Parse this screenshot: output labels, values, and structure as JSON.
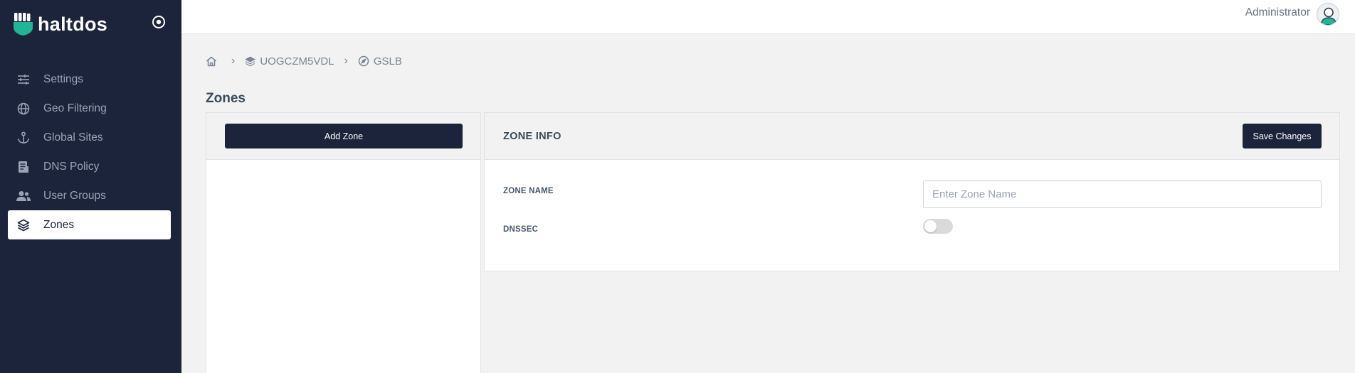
{
  "brand": {
    "name": "haltdos",
    "logo_icon": "fist-shield-icon",
    "accent": "#1fb596"
  },
  "sidebar": {
    "background": "#1b243a",
    "toggle_icon": "target-circle-icon",
    "items": [
      {
        "label": "Settings",
        "icon": "sliders-icon",
        "active": false
      },
      {
        "label": "Geo Filtering",
        "icon": "globe-icon",
        "active": false
      },
      {
        "label": "Global Sites",
        "icon": "anchor-icon",
        "active": false
      },
      {
        "label": "DNS Policy",
        "icon": "document-icon",
        "active": false
      },
      {
        "label": "User Groups",
        "icon": "users-icon",
        "active": false
      },
      {
        "label": "Zones",
        "icon": "layers-icon",
        "active": true
      }
    ]
  },
  "topbar": {
    "user_name": "Administrator",
    "avatar_icon": "user-avatar-icon"
  },
  "breadcrumb": [
    {
      "label": "",
      "icon": "home-icon"
    },
    {
      "label": "UOGCZM5VDL",
      "icon": "layers-icon"
    },
    {
      "label": "GSLB",
      "icon": "compass-icon"
    }
  ],
  "page": {
    "title": "Zones"
  },
  "zones_panel": {
    "add_button": "Add Zone"
  },
  "zone_info": {
    "title": "ZONE INFO",
    "save_button": "Save Changes",
    "zone_name_label": "ZONE NAME",
    "zone_name_value": "",
    "zone_name_placeholder": "Enter Zone Name",
    "dnssec_label": "DNSSEC",
    "dnssec_enabled": false
  }
}
